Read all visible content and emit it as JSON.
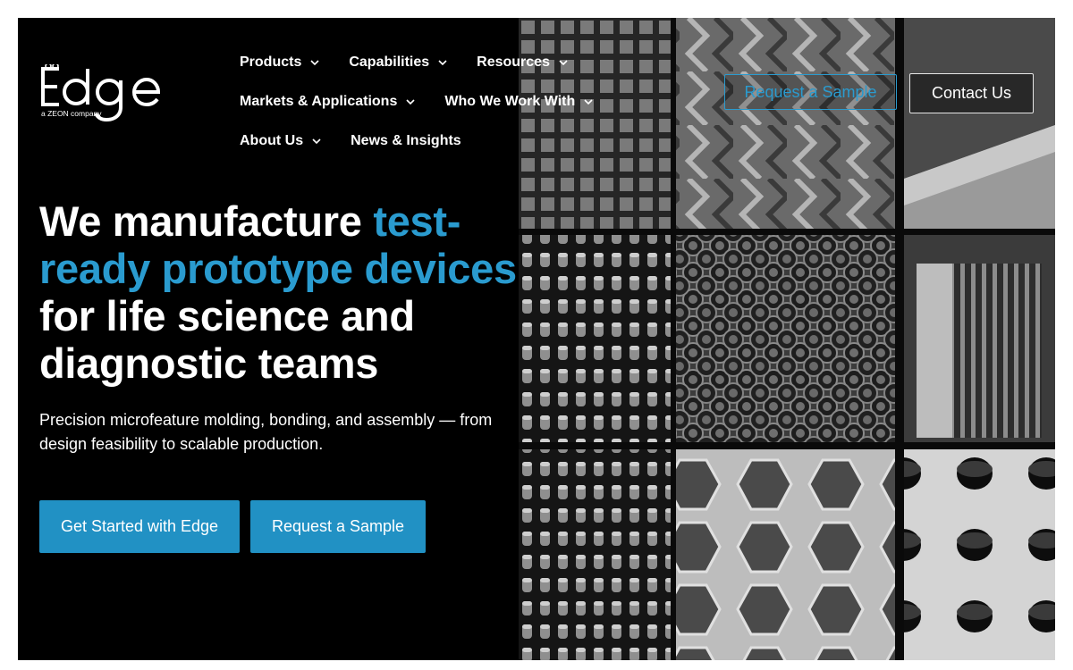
{
  "brand": {
    "logo_word": "Edge",
    "logo_tagline": "a ZEON company"
  },
  "nav": {
    "items": [
      {
        "label": "Products",
        "has_dropdown": true
      },
      {
        "label": "Capabilities",
        "has_dropdown": true
      },
      {
        "label": "Resources",
        "has_dropdown": true
      },
      {
        "label": "Markets & Applications",
        "has_dropdown": true
      },
      {
        "label": "Who We Work With",
        "has_dropdown": true
      },
      {
        "label": "About Us",
        "has_dropdown": true
      },
      {
        "label": "News & Insights",
        "has_dropdown": false
      }
    ],
    "request_sample_label": "Request a Sample",
    "contact_label": "Contact Us"
  },
  "hero": {
    "headline_lead": "We manufacture ",
    "headline_accent": "test-ready prototype devices",
    "headline_tail": " for life science and diagnostic teams",
    "subhead": "Precision microfeature molding, bonding, and assembly — from design feasibility to scalable production.",
    "cta_primary": "Get Started with Edge",
    "cta_secondary": "Request a Sample"
  },
  "colors": {
    "accent": "#2a9bcf",
    "button": "#2191c4",
    "background": "#000000",
    "text": "#ffffff"
  },
  "icons": {
    "dropdown": "chevron-down-icon"
  }
}
